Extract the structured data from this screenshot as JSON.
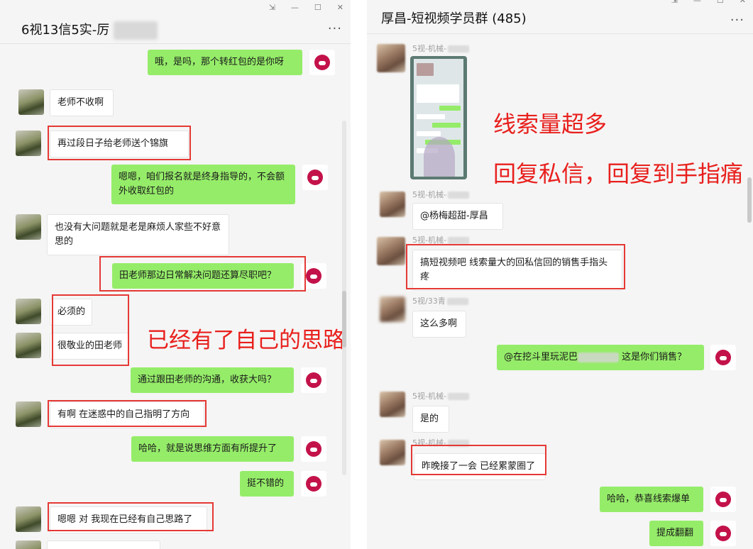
{
  "left": {
    "title": "6视13信5实-厉",
    "window_controls": [
      "⇲",
      "—",
      "☐",
      "✕"
    ],
    "more": "···",
    "messages": [
      {
        "side": "out",
        "text": "哦，是吗，那个转红包的是你呀"
      },
      {
        "side": "in",
        "text": "老师不收啊"
      },
      {
        "side": "in",
        "text": "再过段日子给老师送个锦旗"
      },
      {
        "side": "out",
        "text": "嗯嗯，咱们报名就是终身指导的，不会额外收取红包的"
      },
      {
        "side": "in",
        "text": "也没有大问题就是老是麻烦人家些不好意思的"
      },
      {
        "side": "out",
        "text": "田老师那边日常解决问题还算尽职吧？"
      },
      {
        "side": "in",
        "text": "必须的"
      },
      {
        "side": "in",
        "text": "很敬业的田老师"
      },
      {
        "side": "out",
        "text": "通过跟田老师的沟通，收获大吗？"
      },
      {
        "side": "in",
        "text": "有啊 在迷惑中的自己指明了方向"
      },
      {
        "side": "out",
        "text": "哈哈，就是说思维方面有所提升了"
      },
      {
        "side": "out",
        "text": "挺不错的"
      },
      {
        "side": "in",
        "text": "嗯嗯 对 我现在已经有自己思路了"
      }
    ],
    "annotation": "已经有了自己的思路"
  },
  "right": {
    "title": "厚昌-短视频学员群 (485)",
    "window_controls": [
      "⇲",
      "—",
      "☐",
      "✕"
    ],
    "more": "···",
    "messages": [
      {
        "side": "in",
        "sender": "5视-机械-",
        "text": ""
      },
      {
        "side": "in",
        "sender": "5视-机械-",
        "text": "@杨梅超甜-厚昌"
      },
      {
        "side": "in",
        "sender": "5视-机械-",
        "text": "搞短视频吧 线索量大的回私信回的销售手指头疼"
      },
      {
        "side": "in",
        "sender": "5视/33青",
        "text": "这么多啊"
      },
      {
        "side": "out",
        "text_a": "@在挖斗里玩泥巴",
        "text_b": "这是你们销售？"
      },
      {
        "side": "in",
        "sender": "5视-机械-",
        "text": "是的"
      },
      {
        "side": "in",
        "sender": "5视-机械-",
        "text": "昨晚接了一会 已经累蒙圈了"
      },
      {
        "side": "out",
        "text": "哈哈，恭喜线索爆单"
      },
      {
        "side": "out",
        "text": "提成翻翻"
      }
    ],
    "annotation_1": "线索量超多",
    "annotation_2": "回复私信，回复到手指痛"
  }
}
